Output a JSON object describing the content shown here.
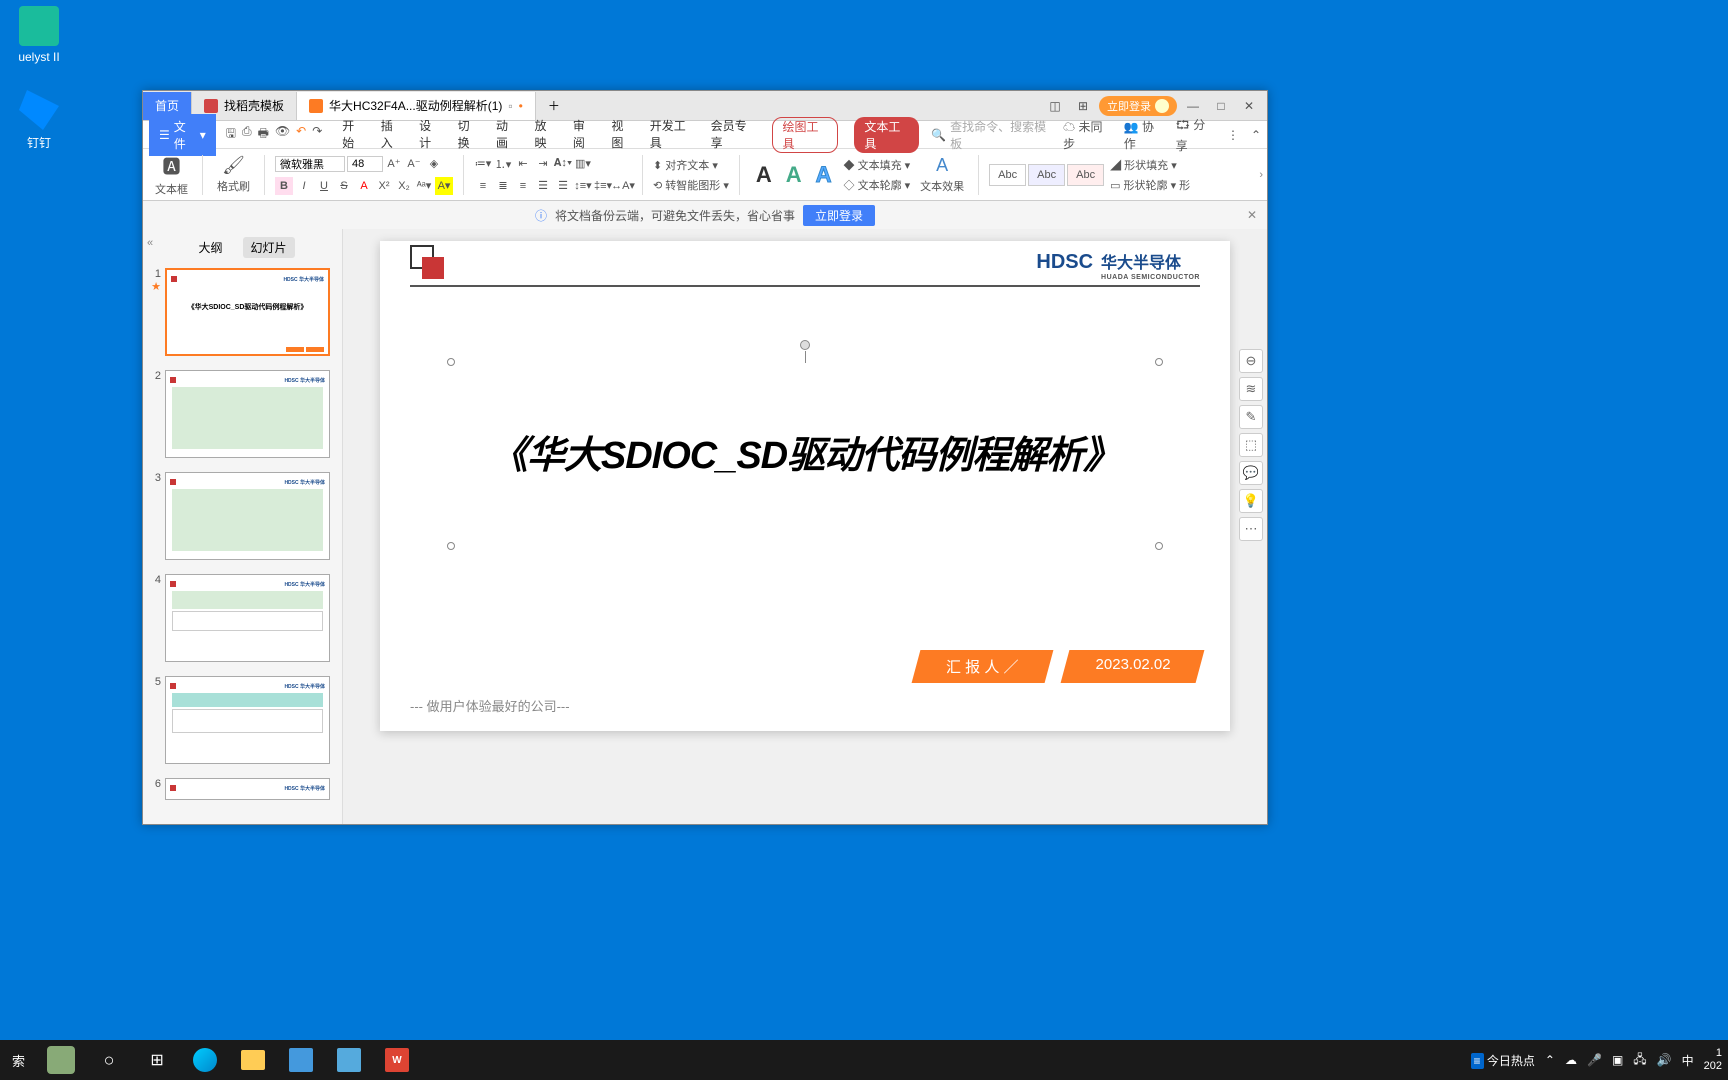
{
  "desktop": {
    "icons": [
      {
        "label": "uelyst II",
        "color": "#1abc9c"
      },
      {
        "label": "钉钉",
        "color": "#0089ff"
      }
    ]
  },
  "window": {
    "tabs": {
      "home": "首页",
      "template": "找稻壳模板",
      "document": "华大HC32F4A...驱动例程解析(1)"
    },
    "login": "立即登录",
    "menu": {
      "file": "文件",
      "items": [
        "开始",
        "插入",
        "设计",
        "切换",
        "动画",
        "放映",
        "审阅",
        "视图",
        "开发工具",
        "会员专享"
      ],
      "draw_tool": "绘图工具",
      "text_tool": "文本工具",
      "search_ph": "查找命令、搜索模板",
      "sync": "未同步",
      "collab": "协作",
      "share": "分享"
    },
    "ribbon": {
      "textbox": "文本框",
      "format_painter": "格式刷",
      "font_name": "微软雅黑",
      "font_size": "48",
      "align_text": "对齐文本",
      "smart_shape": "转智能图形",
      "fill_text": "文本填充",
      "outline_text": "文本轮廓",
      "text_effect": "文本效果",
      "style_label": "Abc",
      "shape_fill": "形状填充",
      "shape_outline": "形状轮廓",
      "shape_more": "形"
    },
    "notice": {
      "text": "将文档备份云端，可避免文件丢失，省心省事",
      "action": "立即登录"
    },
    "panel": {
      "outline": "大纲",
      "slides": "幻灯片"
    },
    "slide": {
      "logo_en": "HDSC",
      "logo_cn": "华大半导体",
      "logo_sub": "HUADA SEMICONDUCTOR",
      "title": "《华大SDIOC_SD驱动代码例程解析》",
      "thumb_title": "《华大SDIOC_SD驱动代码例程解析》",
      "reporter": "汇 报 人 ／",
      "date": "2023.02.02",
      "tagline": "--- 做用户体验最好的公司---"
    },
    "thumbs": [
      "1",
      "2",
      "3",
      "4",
      "5",
      "6"
    ]
  },
  "taskbar": {
    "search": "索",
    "hotspot": "今日热点",
    "ime": "中",
    "time": "1",
    "date": "202"
  }
}
